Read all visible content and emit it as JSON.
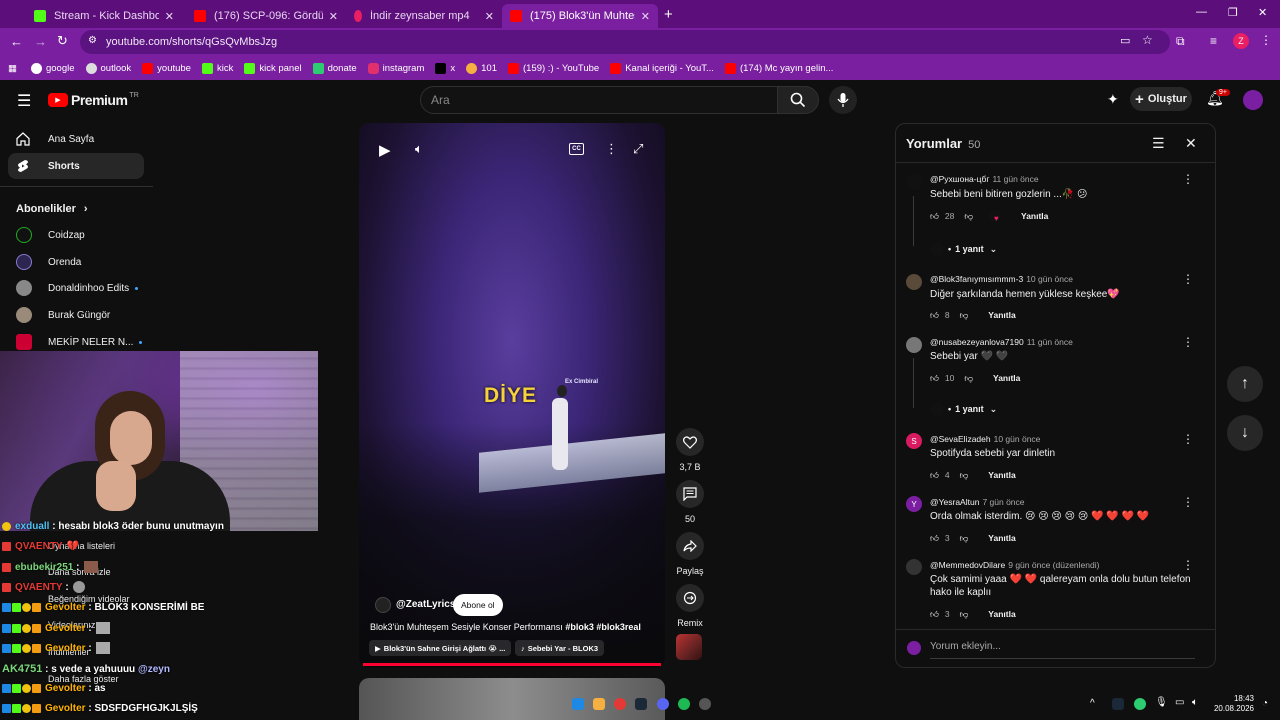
{
  "browser": {
    "tabs": [
      {
        "title": "Stream - Kick Dashboard",
        "color": "#53fc18"
      },
      {
        "title": "(176) SCP-096: Gördün ve Artık",
        "color": "#ff0000"
      },
      {
        "title": "İndir zeynsaber mp4",
        "color": "#e91e63"
      },
      {
        "title": "(175) Blok3'ün Muhteşem Sesiyle",
        "color": "#ff0000"
      }
    ],
    "url": "youtube.com/shorts/qGsQvMbsJzg",
    "profile_letter": "Z",
    "bookmarks": [
      "google",
      "outlook",
      "youtube",
      "kick",
      "kick panel",
      "donate",
      "instagram",
      "x",
      "101",
      "(159) :) - YouTube",
      "Kanal içeriği - YouT...",
      "(174) Mc yayın gelin..."
    ]
  },
  "yt": {
    "logo_text": "Premium",
    "region": "TR",
    "search_placeholder": "Ara",
    "create_label": "Oluştur",
    "notif_count": "9+",
    "nav": [
      {
        "label": "Ana Sayfa",
        "icon": "home-icon"
      },
      {
        "label": "Shorts",
        "icon": "shorts-icon"
      }
    ],
    "subs_heading": "Abonelikler",
    "subs": [
      {
        "name": "Coidzap",
        "dot": false
      },
      {
        "name": "Orenda",
        "dot": false
      },
      {
        "name": "Donaldinhoo Edits",
        "dot": true
      },
      {
        "name": "Burak Güngör",
        "dot": false
      },
      {
        "name": "MEKİP NELER N...",
        "dot": true
      }
    ],
    "more_links": [
      "Oynatma listeleri",
      "Daha sonra izle",
      "Beğendiğim videolar",
      "Videolarınız",
      "İndirilenler",
      "Daha fazla göster"
    ]
  },
  "chat": [
    {
      "user": "exduall",
      "msg": "hesabı blok3 öder bunu unutmayın",
      "user_color": "#4fc3f7"
    },
    {
      "user": "QVAENTY",
      "msg": "",
      "user_color": "#e53935"
    },
    {
      "user": "ebubekir251",
      "msg": ":",
      "user_color": "#7cd67c"
    },
    {
      "user": "QVAENTY",
      "msg": ":",
      "user_color": "#e53935"
    },
    {
      "user": "Gevolter",
      "msg": "BLOK3 KONSERİMİ BE",
      "user_color": "#ffb300"
    },
    {
      "user": "Gevolter",
      "msg": ":",
      "user_color": "#ffb300"
    },
    {
      "user": "Gevolter",
      "msg": ":",
      "user_color": "#ffb300"
    },
    {
      "user": "AK4751",
      "msg": "s vede a yahuuuu",
      "mention": "@zeyn",
      "user_color": "#7cd67c"
    },
    {
      "user": "Gevolter",
      "msg": "as",
      "user_color": "#ffb300"
    },
    {
      "user": "Gevolter",
      "msg": "SDSFDGFHGJKJLŞİŞ",
      "user_color": "#ffb300"
    }
  ],
  "video": {
    "caption_word": "DİYE",
    "channel": "@ZeatLyrics",
    "subscribe_label": "Abone ol",
    "title_text": "Blok3'ün Muhteşem Sesiyle Konser Performansı",
    "hashtags": "#blok3 #blok3real",
    "chip1": "Blok3'ün Sahne Girişi Ağlattı 😭 ...",
    "chip2": "Sebebi Yar - BLOK3",
    "stage_text": "Ex Cimbiral",
    "actions": [
      {
        "label": "3,7 B",
        "icon": "like-icon"
      },
      {
        "label": "50",
        "icon": "comment-icon"
      },
      {
        "label": "Paylaş",
        "icon": "share-icon"
      },
      {
        "label": "Remix",
        "icon": "remix-icon"
      }
    ]
  },
  "comments": {
    "title": "Yorumlar",
    "count": "50",
    "reply_label": "Yanıtla",
    "add_placeholder": "Yorum ekleyin...",
    "items": [
      {
        "author": "@Рухшона-цбг",
        "time": "11 gün önce",
        "text": "Sebebi beni bitiren gozlerin ...🥀 😕",
        "likes": "28",
        "replies": "1 yanıt",
        "avatar_color": "#111111",
        "avatar_letter": ""
      },
      {
        "author": "@Blok3fanıymısımmm-3",
        "time": "10 gün önce",
        "text": "Diğer şarkılanda hemen yüklese keşkee💖",
        "likes": "8",
        "replies": "",
        "avatar_color": "#5a4a3a",
        "avatar_letter": ""
      },
      {
        "author": "@nusabezeyanlova7190",
        "time": "11 gün önce",
        "text": "Sebebi yar 🖤 🖤",
        "likes": "10",
        "replies": "1 yanıt",
        "avatar_color": "#777777",
        "avatar_letter": ""
      },
      {
        "author": "@SevaElizadeh",
        "time": "10 gün önce",
        "text": "Spotifyda sebebi  yar dinletin",
        "likes": "4",
        "replies": "",
        "avatar_color": "#d81b60",
        "avatar_letter": "S"
      },
      {
        "author": "@YesraAltun",
        "time": "7 gün önce",
        "text": "Orda olmak isterdim. 😢 😢 😢 😢 😢 ❤️ ❤️ ❤️ ❤️",
        "likes": "3",
        "replies": "",
        "avatar_color": "#7b1fa2",
        "avatar_letter": "Y"
      },
      {
        "author": "@MemmedovDilare",
        "time": "9 gün önce (düzenlendi)",
        "text": "Çok samimi yaaa ❤️ ❤️  qalereyam onla dolu butun telefon hako ile kaplıı",
        "likes": "3",
        "replies": "",
        "avatar_color": "#333333",
        "avatar_letter": ""
      }
    ]
  },
  "taskbar": {
    "time": "18:43",
    "date": "20.08.2026"
  }
}
